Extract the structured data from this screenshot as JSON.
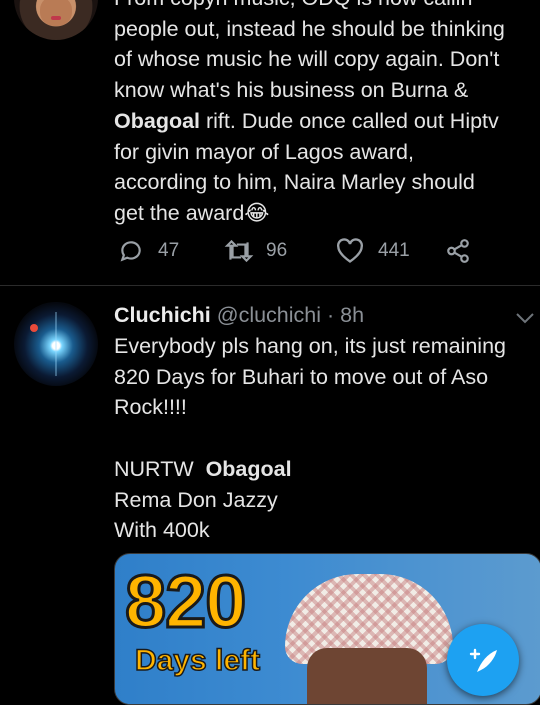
{
  "tweet1": {
    "lines": [
      "From copyri music, ODQ is now callin",
      "people out, instead he should be thinking",
      "of whose music he will copy again. Don't",
      "know what's his business on Burna &",
      "Obagoal",
      " rift. Dude once called out Hiptv",
      "for givin mayor of Lagos award,",
      "according to him, Naira Marley should",
      "get the award😂"
    ],
    "actions": {
      "replies": "47",
      "retweets": "96",
      "likes": "441"
    }
  },
  "tweet2": {
    "display_name": "Cluchichi",
    "handle": "@cluchichi",
    "separator": "·",
    "time": "8h",
    "lines": [
      "Everybody pls hang on, its just remaining",
      "820 Days for Buhari to move out of Aso",
      "Rock!!!!",
      "NURTW",
      "Obagoal",
      "Rema  Don Jazzy",
      "With 400k"
    ],
    "media": {
      "count": "820",
      "caption": "Days left"
    }
  },
  "colors": {
    "accent": "#1da1f2",
    "countdown": "#ffb400",
    "muted": "#9aa0a6"
  },
  "icons": [
    "reply-icon",
    "retweet-icon",
    "like-icon",
    "share-icon",
    "chevron-down-icon",
    "compose-icon"
  ]
}
